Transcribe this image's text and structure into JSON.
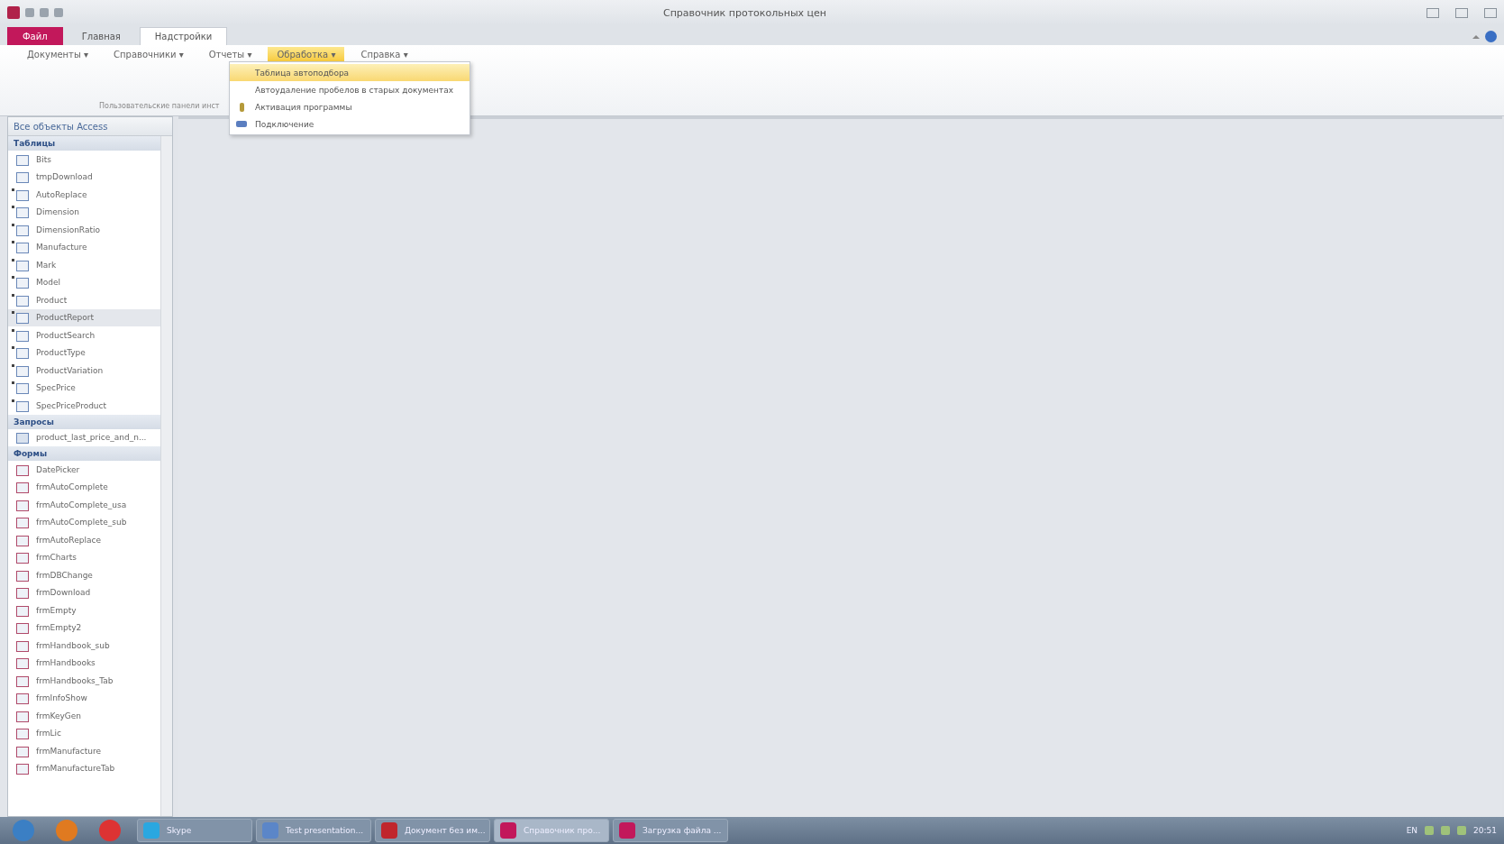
{
  "window": {
    "title": "Справочник протокольных цен"
  },
  "ribbon_tabs": [
    {
      "label": "Файл",
      "kind": "file",
      "selected": false
    },
    {
      "label": "Главная",
      "kind": "tab",
      "selected": false
    },
    {
      "label": "Надстройки",
      "kind": "tab",
      "selected": true
    }
  ],
  "menu": [
    {
      "label": "Документы ▾",
      "selected": false
    },
    {
      "label": "Справочники ▾",
      "selected": false
    },
    {
      "label": "Отчеты ▾",
      "selected": false
    },
    {
      "label": "Обработка ▾",
      "selected": true
    },
    {
      "label": "Справка ▾",
      "selected": false
    }
  ],
  "ribbon_group_label": "Пользовательские панели инст",
  "dropdown": [
    {
      "label": "Таблица автоподбора",
      "kind": "plain",
      "selected": true
    },
    {
      "label": "Автоудаление пробелов в старых документах",
      "kind": "plain",
      "selected": false
    },
    {
      "label": "Активация программы",
      "kind": "key",
      "selected": false
    },
    {
      "label": "Подключение",
      "kind": "plug",
      "selected": false
    }
  ],
  "nav_pane": {
    "title": "Все объекты Access",
    "groups": [
      {
        "title": "Таблицы",
        "kind": "table",
        "items": [
          {
            "label": "Bits",
            "linked": false,
            "selected": false
          },
          {
            "label": "tmpDownload",
            "linked": false,
            "selected": false
          },
          {
            "label": "AutoReplace",
            "linked": true,
            "selected": false
          },
          {
            "label": "Dimension",
            "linked": true,
            "selected": false
          },
          {
            "label": "DimensionRatio",
            "linked": true,
            "selected": false
          },
          {
            "label": "Manufacture",
            "linked": true,
            "selected": false
          },
          {
            "label": "Mark",
            "linked": true,
            "selected": false
          },
          {
            "label": "Model",
            "linked": true,
            "selected": false
          },
          {
            "label": "Product",
            "linked": true,
            "selected": false
          },
          {
            "label": "ProductReport",
            "linked": true,
            "selected": true
          },
          {
            "label": "ProductSearch",
            "linked": true,
            "selected": false
          },
          {
            "label": "ProductType",
            "linked": true,
            "selected": false
          },
          {
            "label": "ProductVariation",
            "linked": true,
            "selected": false
          },
          {
            "label": "SpecPrice",
            "linked": true,
            "selected": false
          },
          {
            "label": "SpecPriceProduct",
            "linked": true,
            "selected": false
          }
        ]
      },
      {
        "title": "Запросы",
        "kind": "query",
        "items": [
          {
            "label": "product_last_price_and_n...",
            "linked": false,
            "selected": false
          }
        ]
      },
      {
        "title": "Формы",
        "kind": "form",
        "items": [
          {
            "label": "DatePicker",
            "linked": false,
            "selected": false
          },
          {
            "label": "frmAutoComplete",
            "linked": false,
            "selected": false
          },
          {
            "label": "frmAutoComplete_usa",
            "linked": false,
            "selected": false
          },
          {
            "label": "frmAutoComplete_sub",
            "linked": false,
            "selected": false
          },
          {
            "label": "frmAutoReplace",
            "linked": false,
            "selected": false
          },
          {
            "label": "frmCharts",
            "linked": false,
            "selected": false
          },
          {
            "label": "frmDBChange",
            "linked": false,
            "selected": false
          },
          {
            "label": "frmDownload",
            "linked": false,
            "selected": false
          },
          {
            "label": "frmEmpty",
            "linked": false,
            "selected": false
          },
          {
            "label": "frmEmpty2",
            "linked": false,
            "selected": false
          },
          {
            "label": "frmHandbook_sub",
            "linked": false,
            "selected": false
          },
          {
            "label": "frmHandbooks",
            "linked": false,
            "selected": false
          },
          {
            "label": "frmHandbooks_Tab",
            "linked": false,
            "selected": false
          },
          {
            "label": "frmInfoShow",
            "linked": false,
            "selected": false
          },
          {
            "label": "frmKeyGen",
            "linked": false,
            "selected": false
          },
          {
            "label": "frmLic",
            "linked": false,
            "selected": false
          },
          {
            "label": "frmManufacture",
            "linked": false,
            "selected": false
          },
          {
            "label": "frmManufactureTab",
            "linked": false,
            "selected": false
          }
        ]
      }
    ]
  },
  "taskbar": {
    "buttons": [
      {
        "label": "Skype",
        "kind": "skype",
        "selected": false
      },
      {
        "label": "Test presentation...",
        "kind": "doc",
        "selected": false
      },
      {
        "label": "Документ без им...",
        "kind": "red",
        "selected": false
      },
      {
        "label": "Справочник про...",
        "kind": "access",
        "selected": true
      },
      {
        "label": "Загрузка файла ...",
        "kind": "access",
        "selected": false
      }
    ],
    "language": "EN",
    "time": "20:51"
  }
}
